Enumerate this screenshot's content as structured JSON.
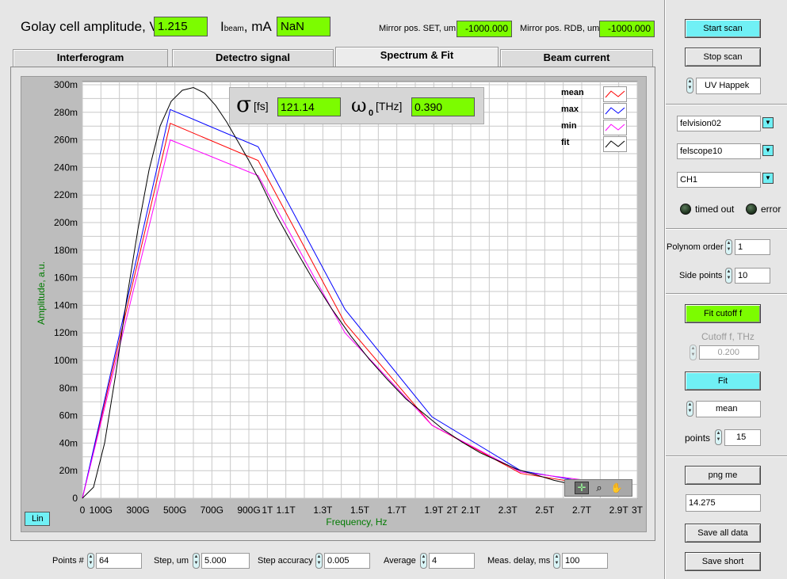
{
  "header": {
    "golay_label": "Golay cell amplitude, V",
    "golay_value": "1.215",
    "ibeam_label_main": "I",
    "ibeam_label_sub": "beam",
    "ibeam_label_unit": ", mA",
    "ibeam_value": "NaN",
    "mirror_set_label": "Mirror pos. SET, um",
    "mirror_set_value": "-1000.000",
    "mirror_rdb_label": "Mirror pos. RDB, um",
    "mirror_rdb_value": "-1000.000"
  },
  "tabs": [
    {
      "label": "Interferogram"
    },
    {
      "label": "Detectro signal"
    },
    {
      "label": "Spectrum & Fit"
    },
    {
      "label": "Beam current"
    }
  ],
  "fit_box": {
    "sigma_symbol": "σ",
    "sigma_unit": "[fs]",
    "sigma_value": "121.14",
    "omega_symbol": "ω",
    "omega_sub": "0",
    "omega_unit": "[THz]",
    "omega_value": "0.390"
  },
  "scale_button": "Lin",
  "chart_data": {
    "type": "line",
    "xlabel": "Frequency, Hz",
    "ylabel": "Amplitude, a.u.",
    "xlim": [
      0,
      3000
    ],
    "ylim": [
      0,
      300
    ],
    "x_ticks": [
      {
        "v": 0,
        "t": "0"
      },
      {
        "v": 100,
        "t": "100G"
      },
      {
        "v": 300,
        "t": "300G"
      },
      {
        "v": 500,
        "t": "500G"
      },
      {
        "v": 700,
        "t": "700G"
      },
      {
        "v": 900,
        "t": "900G"
      },
      {
        "v": 1000,
        "t": "1T"
      },
      {
        "v": 1100,
        "t": "1.1T"
      },
      {
        "v": 1300,
        "t": "1.3T"
      },
      {
        "v": 1500,
        "t": "1.5T"
      },
      {
        "v": 1700,
        "t": "1.7T"
      },
      {
        "v": 1900,
        "t": "1.9T"
      },
      {
        "v": 2000,
        "t": "2T"
      },
      {
        "v": 2100,
        "t": "2.1T"
      },
      {
        "v": 2300,
        "t": "2.3T"
      },
      {
        "v": 2500,
        "t": "2.5T"
      },
      {
        "v": 2700,
        "t": "2.7T"
      },
      {
        "v": 2900,
        "t": "2.9T"
      },
      {
        "v": 3000,
        "t": "3T"
      }
    ],
    "y_ticks": [
      {
        "v": 0,
        "t": "0"
      },
      {
        "v": 20,
        "t": "20m"
      },
      {
        "v": 40,
        "t": "40m"
      },
      {
        "v": 60,
        "t": "60m"
      },
      {
        "v": 80,
        "t": "80m"
      },
      {
        "v": 100,
        "t": "100m"
      },
      {
        "v": 120,
        "t": "120m"
      },
      {
        "v": 140,
        "t": "140m"
      },
      {
        "v": 160,
        "t": "160m"
      },
      {
        "v": 180,
        "t": "180m"
      },
      {
        "v": 200,
        "t": "200m"
      },
      {
        "v": 220,
        "t": "220m"
      },
      {
        "v": 240,
        "t": "240m"
      },
      {
        "v": 260,
        "t": "260m"
      },
      {
        "v": 280,
        "t": "280m"
      },
      {
        "v": 300,
        "t": "300m"
      }
    ],
    "series": [
      {
        "name": "mean",
        "color": "#ff0000",
        "x": [
          0,
          475,
          950,
          1420,
          1890,
          2370,
          2840
        ],
        "y": [
          0,
          272,
          245,
          127,
          53,
          18,
          8
        ]
      },
      {
        "name": "max",
        "color": "#0000ff",
        "x": [
          0,
          475,
          950,
          1420,
          1890,
          2370,
          2840
        ],
        "y": [
          0,
          282,
          255,
          137,
          59,
          20,
          9
        ]
      },
      {
        "name": "min",
        "color": "#ff00ff",
        "x": [
          0,
          475,
          950,
          1420,
          1890,
          2370,
          2840
        ],
        "y": [
          0,
          260,
          234,
          120,
          53,
          19,
          11
        ]
      },
      {
        "name": "fit",
        "color": "#000000",
        "x": [
          0,
          60,
          120,
          180,
          240,
          300,
          360,
          420,
          480,
          540,
          600,
          660,
          720,
          780,
          840,
          900,
          960,
          1050,
          1150,
          1250,
          1350,
          1450,
          1550,
          1650,
          1750,
          1850,
          1950,
          2050,
          2150,
          2250,
          2350,
          2450,
          2550,
          2650,
          2750,
          2850
        ],
        "y": [
          0,
          8,
          40,
          90,
          145,
          195,
          238,
          270,
          288,
          296,
          298,
          294,
          285,
          273,
          259,
          245,
          230,
          205,
          181,
          158,
          137,
          118,
          101,
          86,
          72,
          61,
          50,
          41,
          33,
          27,
          21,
          17,
          13,
          10,
          8,
          6
        ]
      }
    ],
    "legend_position": "top-right",
    "grid": true
  },
  "right_panel": {
    "start_scan": "Start scan",
    "stop_scan": "Stop scan",
    "source_select": "UV Happek",
    "dropdown1": "felvision02",
    "dropdown2": "felscope10",
    "dropdown3": "CH1",
    "timed_out_label": "timed out",
    "error_label": "error",
    "polynom_label": "Polynom order",
    "polynom_value": "1",
    "side_points_label": "Side points",
    "side_points_value": "10",
    "fit_cutoff_button": "Fit cutoff f",
    "cutoff_label": "Cutoff f, THz",
    "cutoff_value": "0.200",
    "fit_button": "Fit",
    "fit_mode": "mean",
    "points_label": "points",
    "points_value": "15",
    "png_button": "png me",
    "png_value": "14.275",
    "save_all_button": "Save all data",
    "save_short_button": "Save short"
  },
  "bottom": {
    "points_label": "Points #",
    "points_value": "64",
    "step_label": "Step, um",
    "step_value": "5.000",
    "accuracy_label": "Step accuracy",
    "accuracy_value": "0.005",
    "average_label": "Average",
    "average_value": "4",
    "delay_label": "Meas. delay, ms",
    "delay_value": "100"
  }
}
